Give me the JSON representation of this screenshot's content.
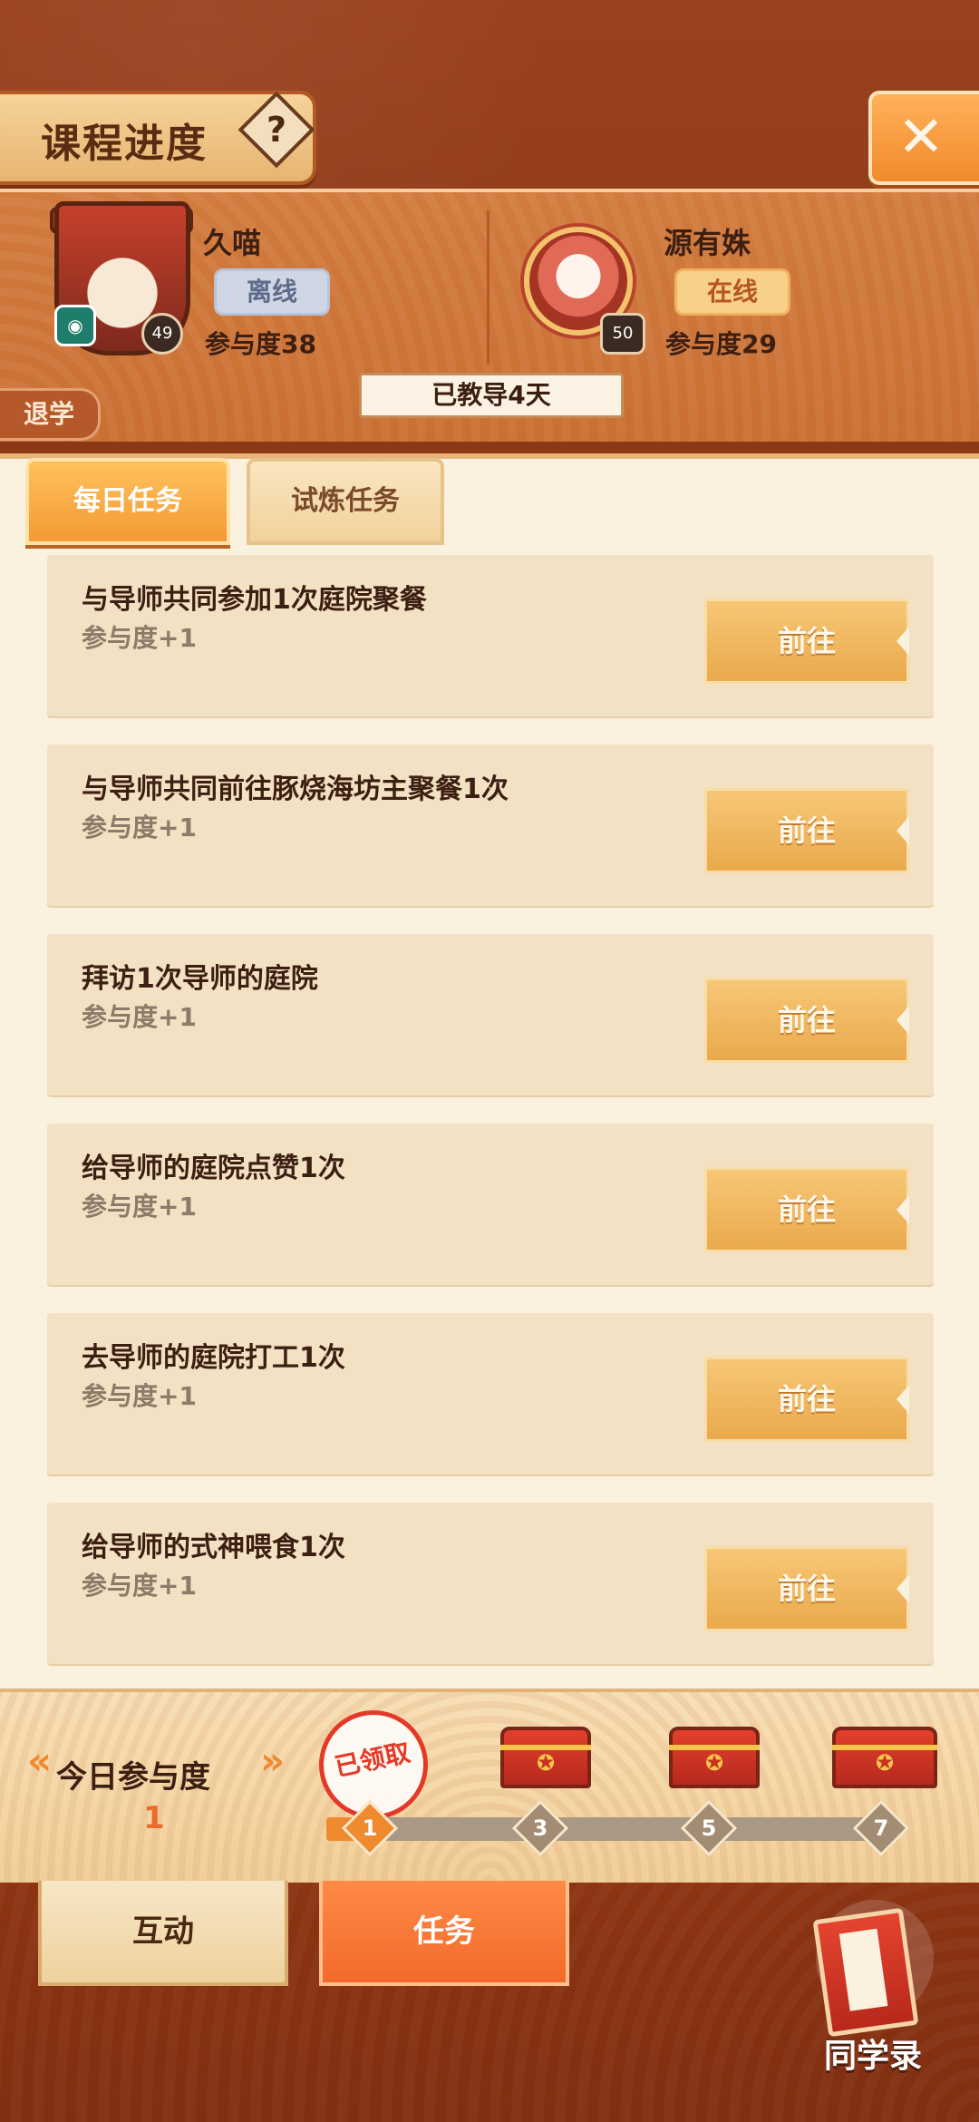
{
  "header": {
    "title": "课程进度",
    "help_icon": "?",
    "close_icon": "✕"
  },
  "mentors": [
    {
      "name": "久喵",
      "status": "离线",
      "level": "49",
      "engagement": "参与度38"
    },
    {
      "name": "源有姝",
      "status": "在线",
      "level": "50",
      "engagement": "参与度29"
    }
  ],
  "taught_days": "已教导4天",
  "quit_label": "退学",
  "tabs": {
    "daily": "每日任务",
    "trial": "试炼任务"
  },
  "tasks": [
    {
      "title": "与导师共同参加1次庭院聚餐",
      "reward": "参与度+1",
      "button": "前往"
    },
    {
      "title": "与导师共同前往豚烧海坊主聚餐1次",
      "reward": "参与度+1",
      "button": "前往"
    },
    {
      "title": "拜访1次导师的庭院",
      "reward": "参与度+1",
      "button": "前往"
    },
    {
      "title": "给导师的庭院点赞1次",
      "reward": "参与度+1",
      "button": "前往"
    },
    {
      "title": "去导师的庭院打工1次",
      "reward": "参与度+1",
      "button": "前往"
    },
    {
      "title": "给导师的式神喂食1次",
      "reward": "参与度+1",
      "button": "前往"
    }
  ],
  "today": {
    "label": "今日参与度",
    "value": "1"
  },
  "milestones": [
    {
      "value": "1",
      "claimed_label": "已领取"
    },
    {
      "value": "3"
    },
    {
      "value": "5"
    },
    {
      "value": "7"
    }
  ],
  "bottom": {
    "interact": "互动",
    "task": "任务",
    "classmates": "同学录"
  },
  "colors": {
    "accent": "#f08a2e",
    "panel": "#fbf1df",
    "header_bg": "#8b3817"
  }
}
